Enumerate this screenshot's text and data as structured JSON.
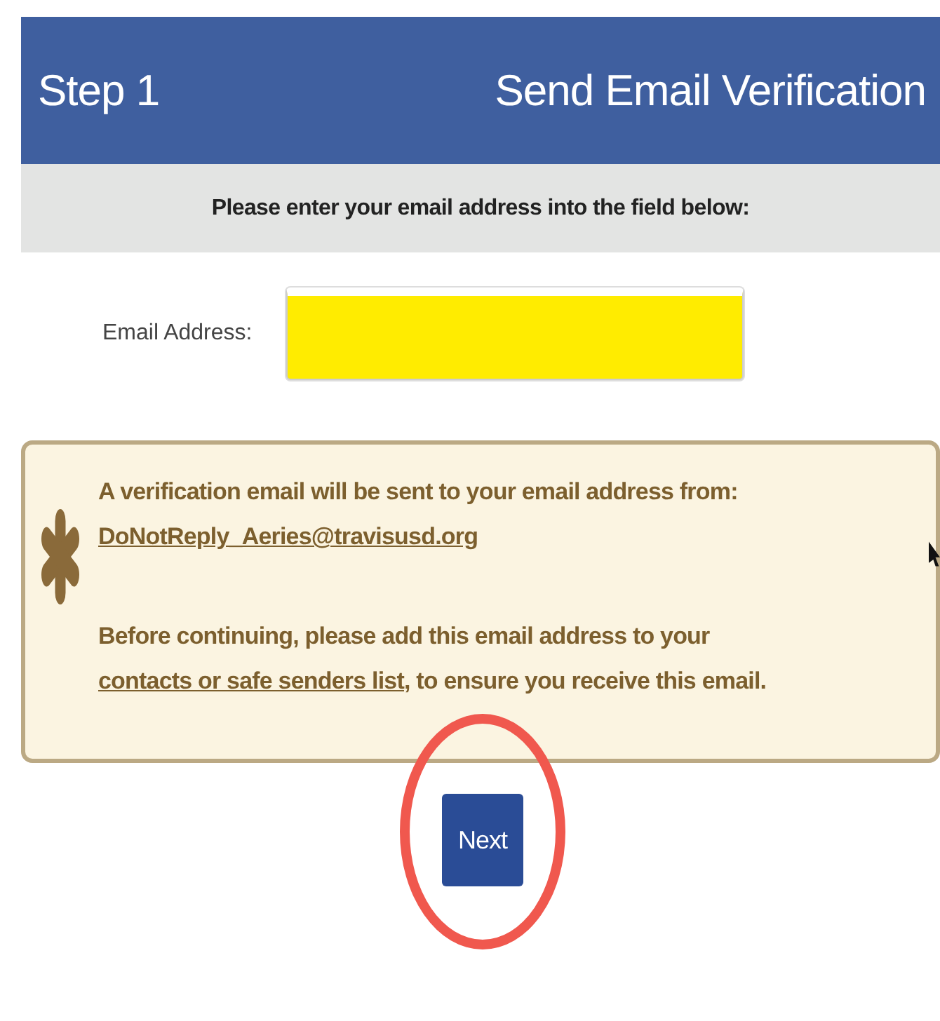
{
  "header": {
    "step": "Step 1",
    "title": "Send Email Verification"
  },
  "instruction": "Please enter your email address into the field below:",
  "email_field": {
    "label": "Email Address:",
    "highlighted": true
  },
  "notice": {
    "message": "A verification email will be sent to your email address from:",
    "sender_link": "DoNotReply_Aeries@travisusd.org",
    "advice_before": "Before continuing, please add this email address to your ",
    "advice_link": "contacts or safe senders list",
    "advice_after": ", to ensure you receive this email."
  },
  "next_button": {
    "label": "Next",
    "circled": true
  }
}
